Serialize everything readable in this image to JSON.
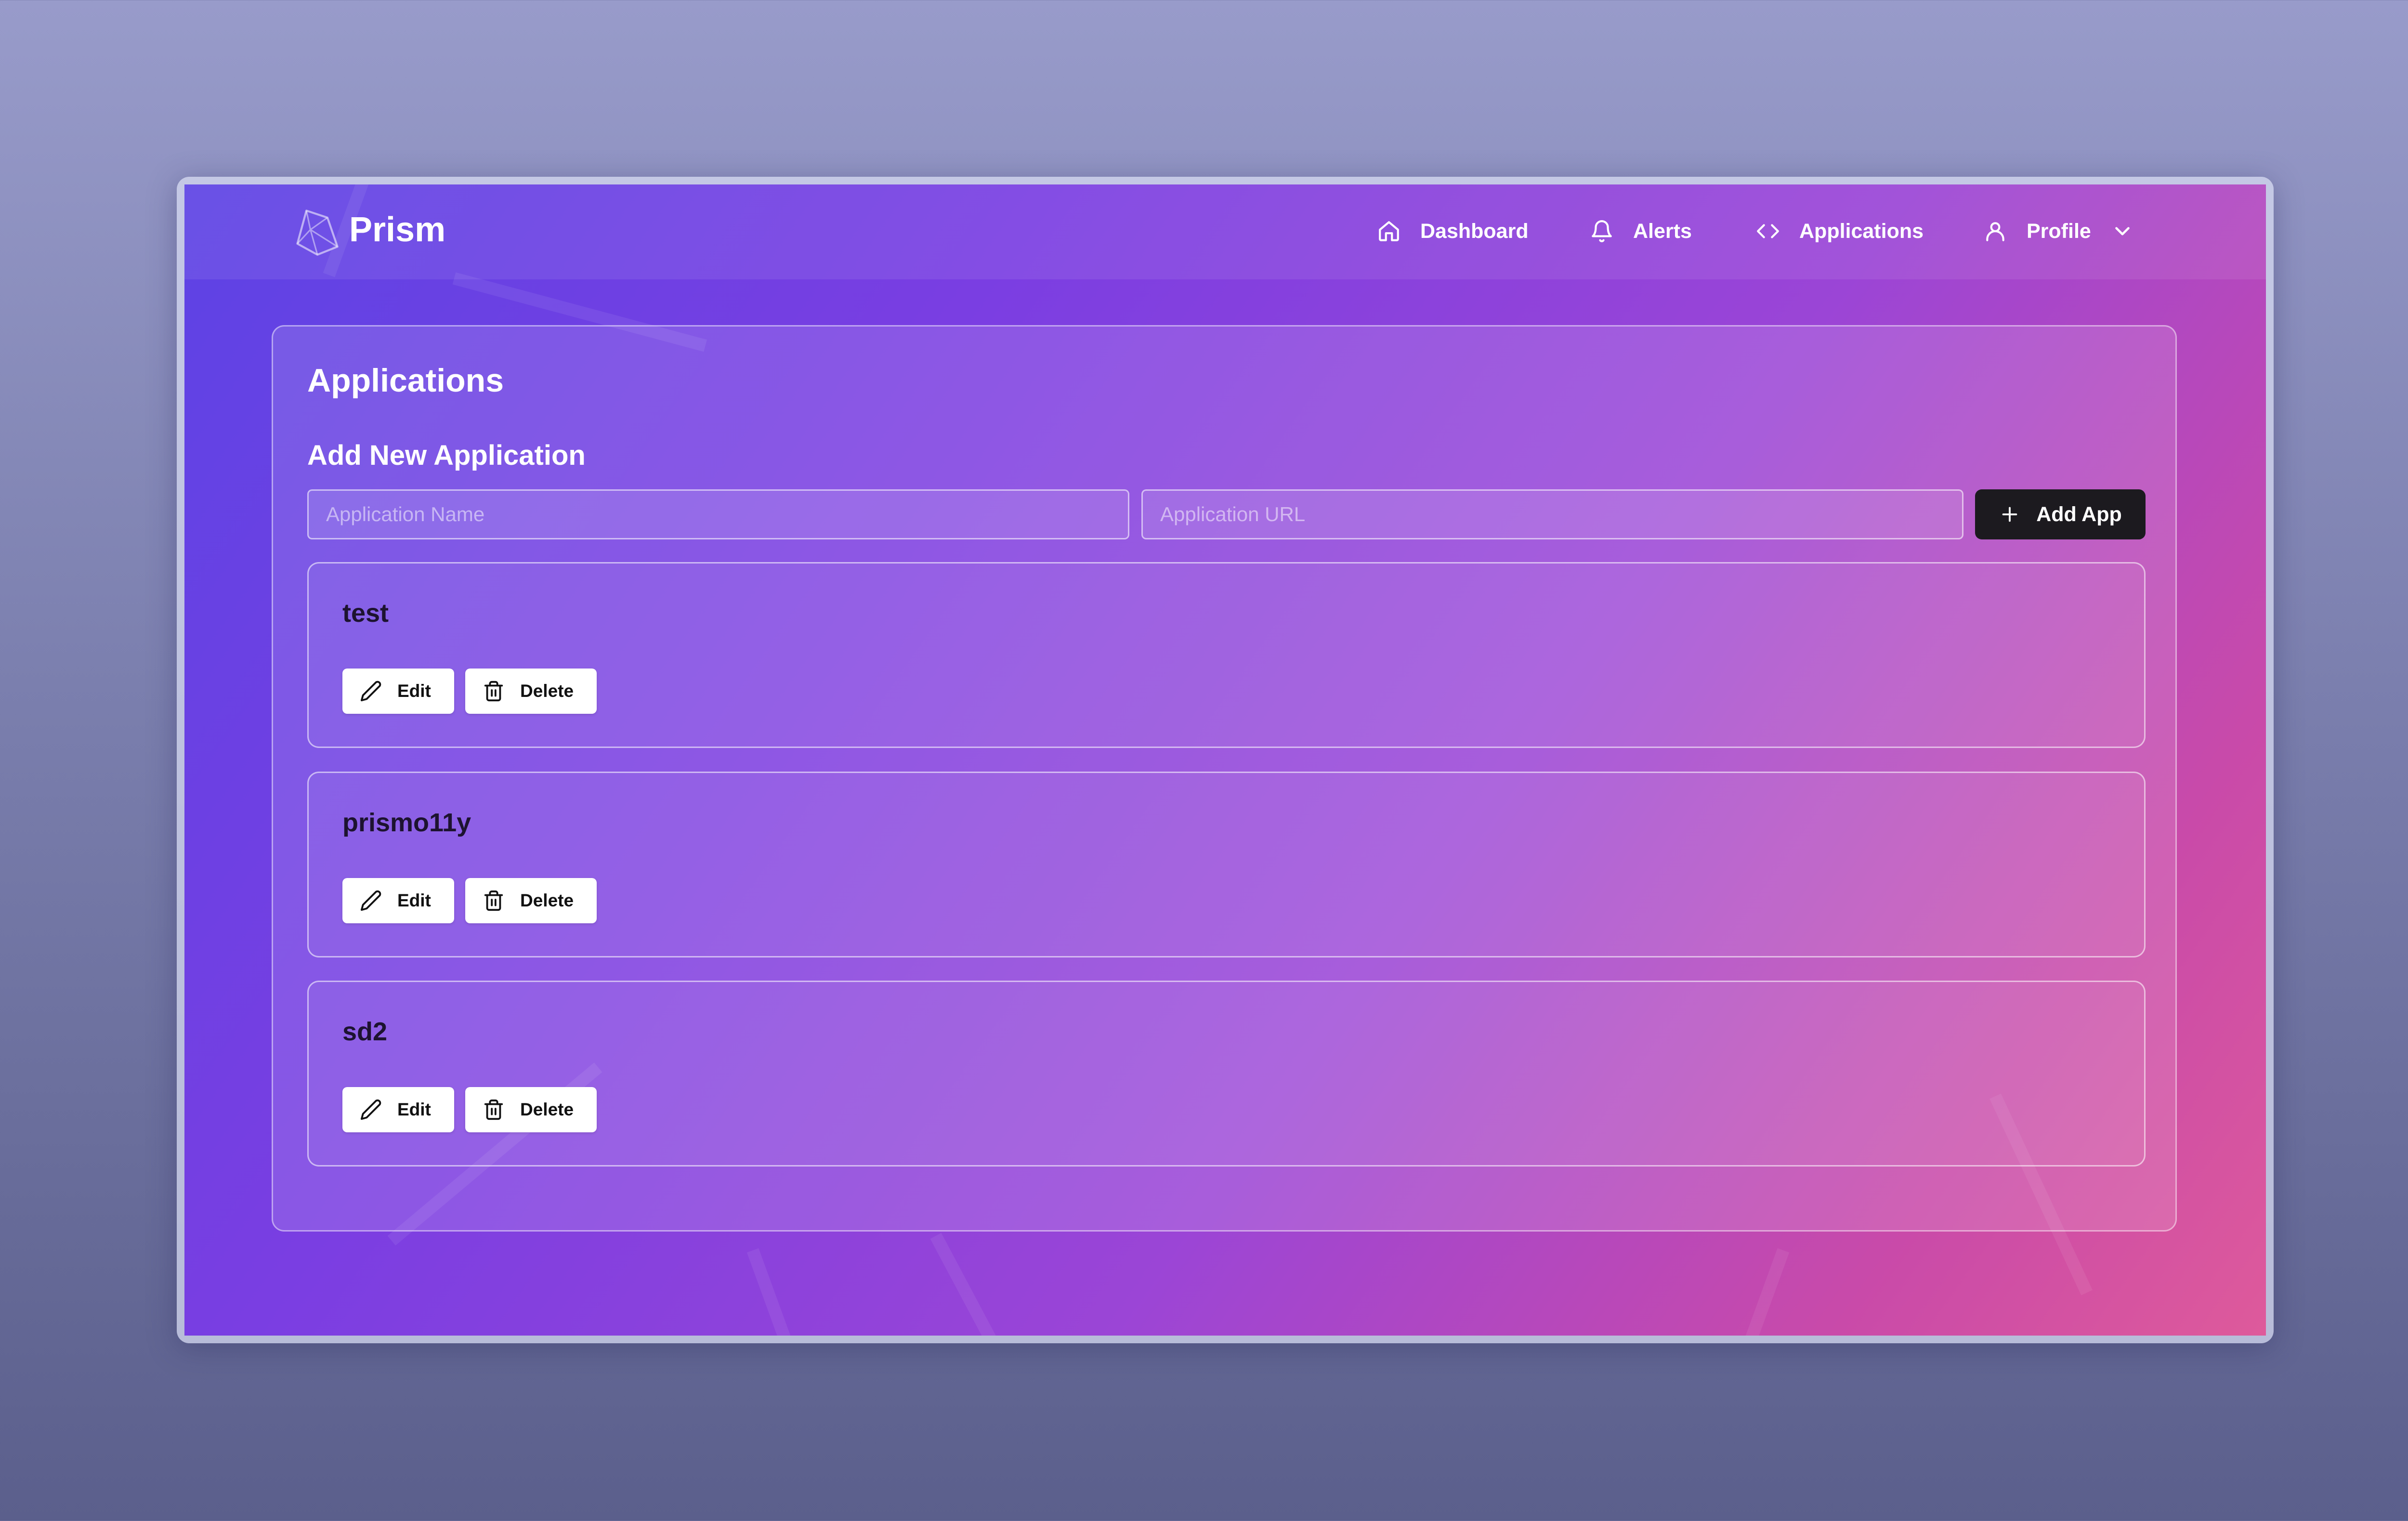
{
  "app": {
    "brand": "Prism"
  },
  "nav": {
    "items": [
      {
        "label": "Dashboard",
        "icon": "home-icon"
      },
      {
        "label": "Alerts",
        "icon": "bell-icon"
      },
      {
        "label": "Applications",
        "icon": "code-icon"
      },
      {
        "label": "Profile",
        "icon": "user-icon"
      }
    ],
    "profile_dropdown_icon": "chevron-down-icon"
  },
  "page": {
    "title": "Applications",
    "add_section_title": "Add New Application",
    "name_placeholder": "Application Name",
    "url_placeholder": "Application URL",
    "name_value": "",
    "url_value": "",
    "add_button_label": "Add App"
  },
  "applications": [
    {
      "name": "test",
      "edit_label": "Edit",
      "delete_label": "Delete"
    },
    {
      "name": "prismo11y",
      "edit_label": "Edit",
      "delete_label": "Delete"
    },
    {
      "name": "sd2",
      "edit_label": "Edit",
      "delete_label": "Delete"
    }
  ],
  "colors": {
    "gradient_start": "#5d43e4",
    "gradient_mid": "#9b45d6",
    "gradient_end": "#de5a9b",
    "primary_button": "#1c1a1f",
    "text_on_dark": "#ffffff"
  }
}
